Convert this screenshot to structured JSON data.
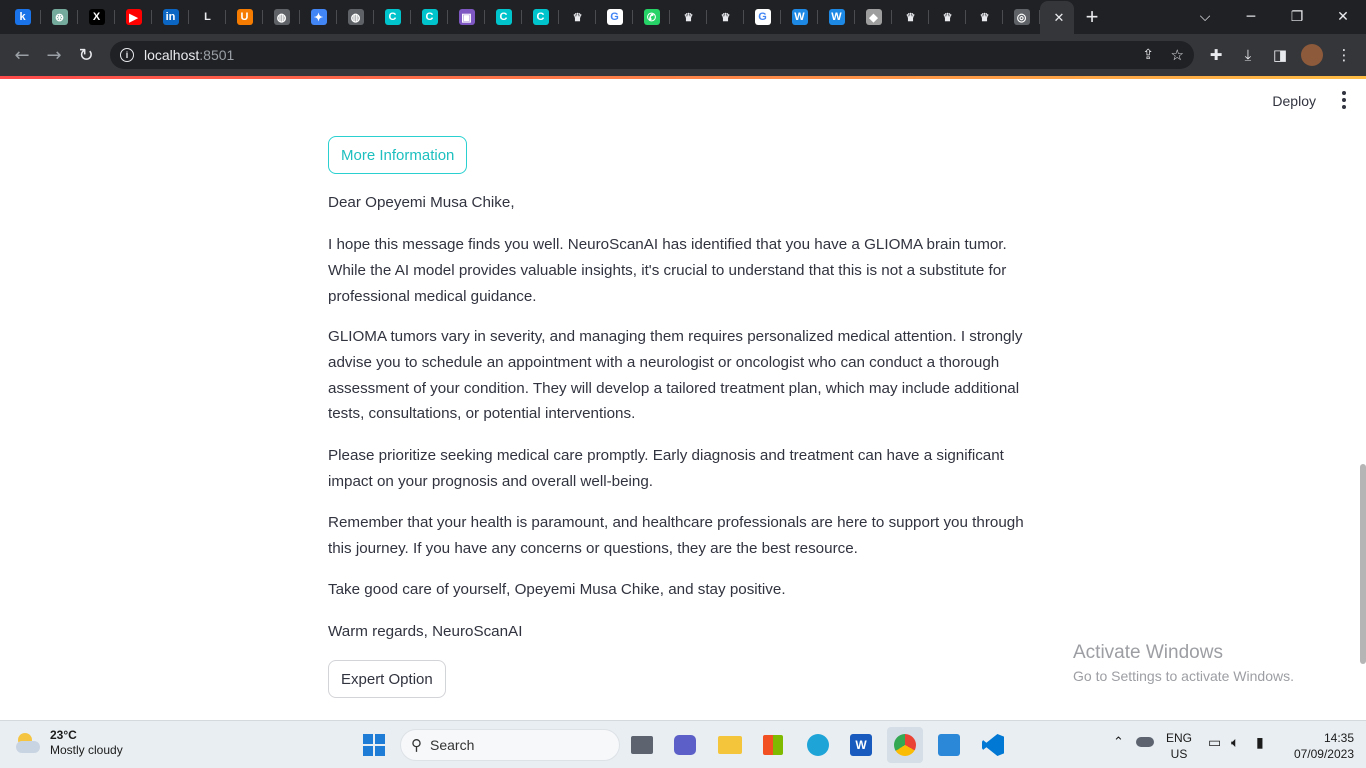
{
  "browser": {
    "tabs": [
      {
        "icon": "k-icon",
        "color": "#1a73e8",
        "glyph": "k"
      },
      {
        "icon": "chatgpt-icon",
        "color": "#74aa9c",
        "glyph": "⊛"
      },
      {
        "icon": "x-icon",
        "color": "#000000",
        "glyph": "X"
      },
      {
        "icon": "youtube-icon",
        "color": "#ff0000",
        "glyph": "▶"
      },
      {
        "icon": "linkedin-icon",
        "color": "#0a66c2",
        "glyph": "in"
      },
      {
        "icon": "loom-icon",
        "color": "#202124",
        "glyph": "L"
      },
      {
        "icon": "orange-logo-icon",
        "color": "#f57c00",
        "glyph": "U"
      },
      {
        "icon": "globe-icon",
        "color": "#5f6368",
        "glyph": "◍"
      },
      {
        "icon": "blue-star-icon",
        "color": "#4285f4",
        "glyph": "✦"
      },
      {
        "icon": "globe-icon",
        "color": "#5f6368",
        "glyph": "◍"
      },
      {
        "icon": "canva-icon",
        "color": "#00c4cc",
        "glyph": "C"
      },
      {
        "icon": "canva-icon",
        "color": "#00c4cc",
        "glyph": "C"
      },
      {
        "icon": "purple-app-icon",
        "color": "#7e57c2",
        "glyph": "▣"
      },
      {
        "icon": "canva-icon",
        "color": "#00c4cc",
        "glyph": "C"
      },
      {
        "icon": "canva-icon",
        "color": "#00c4cc",
        "glyph": "C"
      },
      {
        "icon": "crown-icon",
        "color": "#202124",
        "glyph": "♛"
      },
      {
        "icon": "google-icon",
        "color": "#ffffff",
        "glyph": "G"
      },
      {
        "icon": "whatsapp-icon",
        "color": "#25d366",
        "glyph": "✆"
      },
      {
        "icon": "crown-icon",
        "color": "#202124",
        "glyph": "♛"
      },
      {
        "icon": "crown-icon",
        "color": "#202124",
        "glyph": "♛"
      },
      {
        "icon": "google-icon",
        "color": "#ffffff",
        "glyph": "G"
      },
      {
        "icon": "w-logo-icon",
        "color": "#1e88e5",
        "glyph": "W"
      },
      {
        "icon": "w-logo-icon",
        "color": "#1e88e5",
        "glyph": "W"
      },
      {
        "icon": "layers-icon",
        "color": "#9e9e9e",
        "glyph": "◆"
      },
      {
        "icon": "crown-icon",
        "color": "#202124",
        "glyph": "♛"
      },
      {
        "icon": "crown-icon",
        "color": "#202124",
        "glyph": "♛"
      },
      {
        "icon": "crown-icon",
        "color": "#202124",
        "glyph": "♛"
      },
      {
        "icon": "chrome-icon",
        "color": "#5f6368",
        "glyph": "◎"
      }
    ],
    "active_tab_glyph": "",
    "url_host": "localhost",
    "url_port": ":8501"
  },
  "app": {
    "deploy_label": "Deploy",
    "more_info_button": "More Information",
    "greeting": "Dear Opeyemi Musa Chike,",
    "paragraphs": [
      "I hope this message finds you well. NeuroScanAI has identified that you have a GLIOMA brain tumor. While the AI model provides valuable insights, it's crucial to understand that this is not a substitute for professional medical guidance.",
      "GLIOMA tumors vary in severity, and managing them requires personalized medical attention. I strongly advise you to schedule an appointment with a neurologist or oncologist who can conduct a thorough assessment of your condition. They will develop a tailored treatment plan, which may include additional tests, consultations, or potential interventions.",
      "Please prioritize seeking medical care promptly. Early diagnosis and treatment can have a significant impact on your prognosis and overall well-being.",
      "Remember that your health is paramount, and healthcare professionals are here to support you through this journey. If you have any concerns or questions, they are the best resource.",
      "Take good care of yourself, Opeyemi Musa Chike, and stay positive.",
      "Warm regards, NeuroScanAI"
    ],
    "expert_button": "Expert Option"
  },
  "watermark": {
    "title": "Activate Windows",
    "subtitle": "Go to Settings to activate Windows."
  },
  "taskbar": {
    "temperature": "23°C",
    "weather": "Mostly cloudy",
    "search_label": "Search",
    "language": "ENG",
    "region": "US",
    "time": "14:35",
    "date": "07/09/2023"
  }
}
